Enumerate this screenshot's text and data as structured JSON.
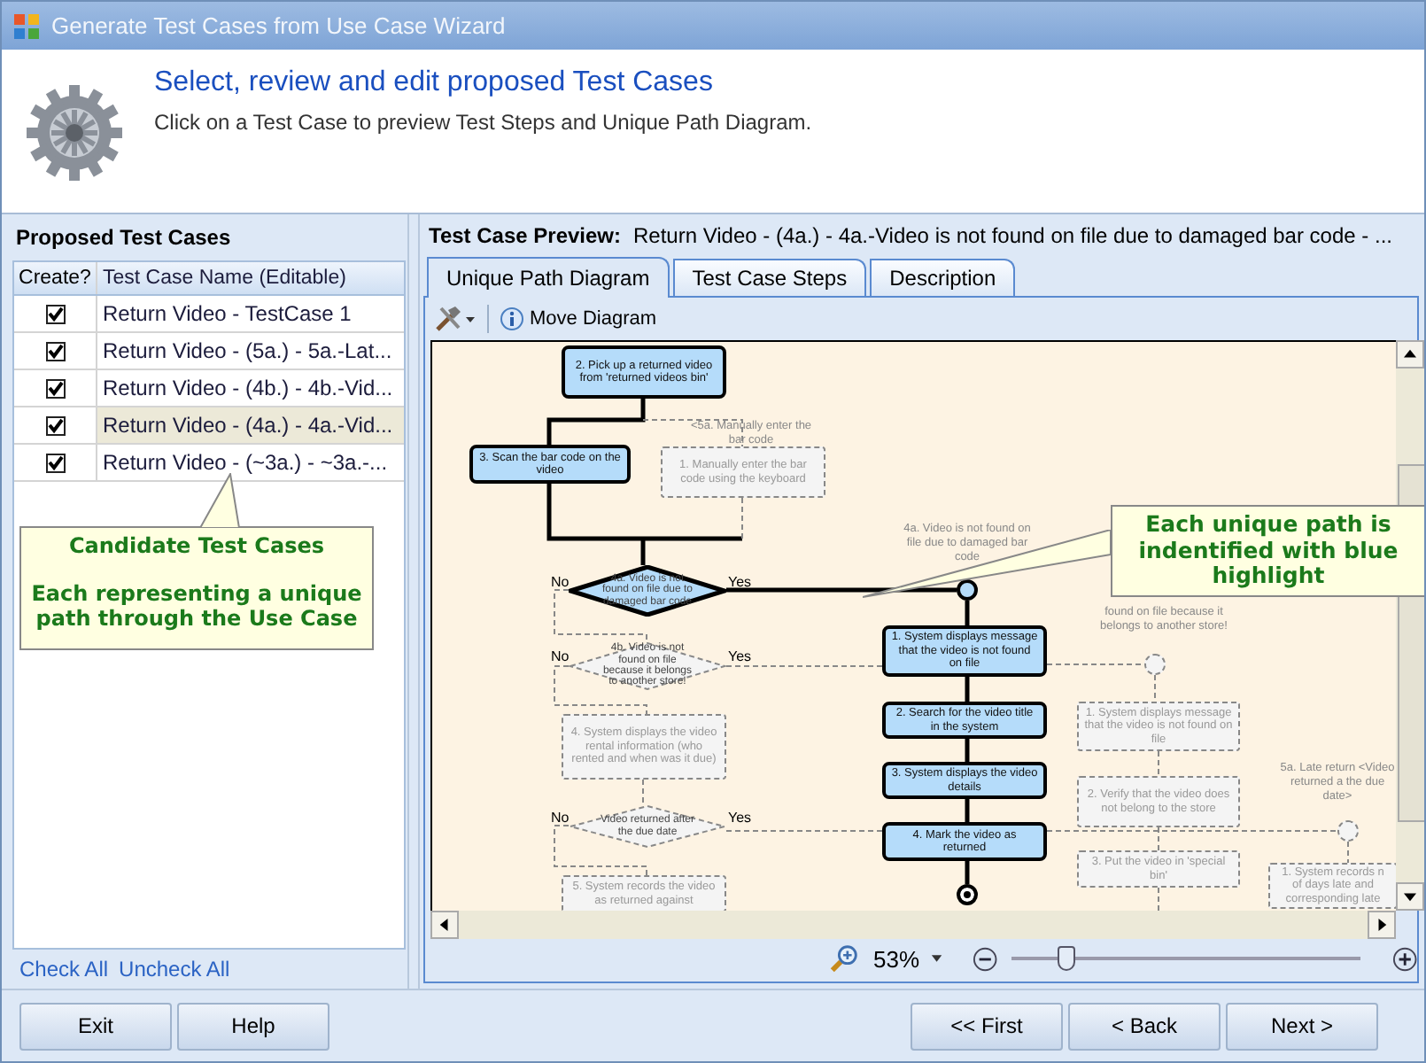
{
  "window": {
    "title": "Generate Test Cases from Use Case Wizard"
  },
  "header": {
    "heading": "Select, review and edit proposed Test Cases",
    "subtitle": "Click on a Test Case to preview Test Steps and Unique Path Diagram."
  },
  "test_cases_panel": {
    "title": "Proposed Test Cases",
    "columns": [
      "Create?",
      "Test Case Name (Editable)"
    ],
    "rows": [
      {
        "checked": true,
        "name": "Return Video - TestCase 1",
        "selected": false
      },
      {
        "checked": true,
        "name": "Return Video - (5a.) - 5a.-Lat...",
        "selected": false
      },
      {
        "checked": true,
        "name": "Return Video - (4b.) - 4b.-Vid...",
        "selected": false
      },
      {
        "checked": true,
        "name": "Return Video - (4a.) - 4a.-Vid...",
        "selected": true
      },
      {
        "checked": true,
        "name": "Return Video - (~3a.) - ~3a.-...",
        "selected": false
      }
    ],
    "callout": {
      "title": "Candidate Test Cases",
      "body": "Each representing a unique path through the Use Case"
    },
    "links": [
      "Check All",
      "Uncheck All"
    ]
  },
  "preview": {
    "label": "Test Case Preview:",
    "value": "Return Video - (4a.) - 4a.-Video is not found on file due to damaged bar code - ...",
    "tabs": [
      {
        "label": "Unique Path Diagram",
        "selected": true
      },
      {
        "label": "Test Case Steps",
        "selected": false
      },
      {
        "label": "Description",
        "selected": false
      }
    ],
    "toolbar": {
      "move_diagram": "Move Diagram"
    },
    "diagram": {
      "nodes": [
        {
          "kind": "step",
          "text": "2.  Pick up a returned video from 'returned videos bin'",
          "highlighted": true
        },
        {
          "kind": "step",
          "text": "3.  Scan the bar code on the video",
          "highlighted": true
        },
        {
          "kind": "label",
          "text": "<5a. Manually enter the bar code"
        },
        {
          "kind": "step",
          "text": "1.  Manually enter the bar code using the keyboard",
          "highlighted": false
        },
        {
          "kind": "decision",
          "text": "4a. Video is not found on file due to damaged bar code",
          "no": "No",
          "yes": "Yes",
          "highlighted": true
        },
        {
          "kind": "decision",
          "text": "4b. Video is not found on file because it belongs to another store!",
          "no": "No",
          "yes": "Yes",
          "highlighted": false
        },
        {
          "kind": "step",
          "text": "4.  System displays the video rental information (who rented and when was it due)",
          "highlighted": false
        },
        {
          "kind": "decision",
          "text": "Video returned after the due date",
          "no": "No",
          "yes": "Yes",
          "highlighted": false
        },
        {
          "kind": "step",
          "text": "5.  System records the video as returned against",
          "highlighted": false
        },
        {
          "kind": "label",
          "text": "4a. Video is not found on file due to damaged bar code"
        },
        {
          "kind": "merge",
          "highlighted": true
        },
        {
          "kind": "step",
          "text": "1.  System displays message that the video is not found on file",
          "highlighted": true
        },
        {
          "kind": "step",
          "text": "2.  Search for the video title in the system",
          "highlighted": true
        },
        {
          "kind": "step",
          "text": "3.  System displays the video details",
          "highlighted": true
        },
        {
          "kind": "step",
          "text": "4.  Mark the video as returned",
          "highlighted": true
        },
        {
          "kind": "end",
          "highlighted": true
        },
        {
          "kind": "label",
          "text": "found on file because it belongs to another store!"
        },
        {
          "kind": "merge",
          "highlighted": false
        },
        {
          "kind": "step",
          "text": "1.  System displays message that the video is not found on file",
          "highlighted": false
        },
        {
          "kind": "step",
          "text": "2.  Verify that the video does not belong to the store",
          "highlighted": false
        },
        {
          "kind": "step",
          "text": "3.  Put the video in 'special bin'",
          "highlighted": false
        },
        {
          "kind": "label",
          "text": "5a. Late return <Video returned a the due date>"
        },
        {
          "kind": "merge",
          "highlighted": false
        },
        {
          "kind": "step",
          "text": "1.  System records n of days late and corresponding late",
          "highlighted": false
        }
      ],
      "callout": "Each unique path is indentified with blue highlight"
    },
    "zoom": {
      "value": "53%",
      "level": 0.16
    }
  },
  "buttons": {
    "left": [
      "Exit",
      "Help"
    ],
    "right": [
      "<< First",
      "< Back",
      "Next >"
    ]
  }
}
